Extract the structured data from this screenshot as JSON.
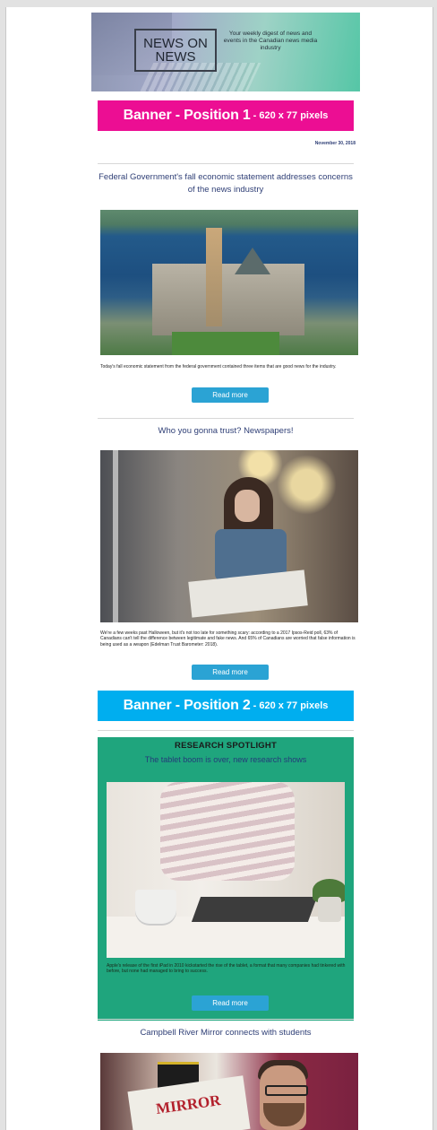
{
  "header": {
    "logo_line1": "NEWS ON",
    "logo_line2": "NEWS",
    "tagline": "Your weekly digest of news and events in the Canadian news media industry"
  },
  "banners": [
    {
      "main": "Banner - Position 1",
      "dims": "- 620 x 77 pixels",
      "color": "#ec0e93"
    },
    {
      "main": "Banner - Position 2",
      "dims": "- 620 x 77 pixels",
      "color": "#00aeef"
    }
  ],
  "date": "November 30, 2018",
  "articles": [
    {
      "headline": "Federal Government's fall economic statement addresses concerns of the news industry",
      "summary": "Today's fall economic statement from the federal government contained three items that are good news for the industry.",
      "button": "Read more"
    },
    {
      "headline": "Who you gonna trust? Newspapers!",
      "summary": "We're a few weeks past Halloween, but it's not too late for something scary: according to a 2017 Ipsos-Reid poll, 63% of Canadians can't tell the difference between legitimate and fake news. And 65% of Canadians are worried that false information is being used as a weapon (Edelman Trust Barometer: 2018).",
      "button": "Read more"
    }
  ],
  "research": {
    "title": "RESEARCH SPOTLIGHT",
    "subtitle": "The tablet boom is over, new research shows",
    "summary": "Apple's release of the first iPad in 2010 kickstarted the rise of the tablet, a format that many companies had tinkered with before, but none had managed to bring to success.",
    "button": "Read more",
    "bg_color": "#1fa57d"
  },
  "final_article": {
    "headline": "Campbell River Mirror connects with students",
    "photo_text": "MIRROR"
  }
}
